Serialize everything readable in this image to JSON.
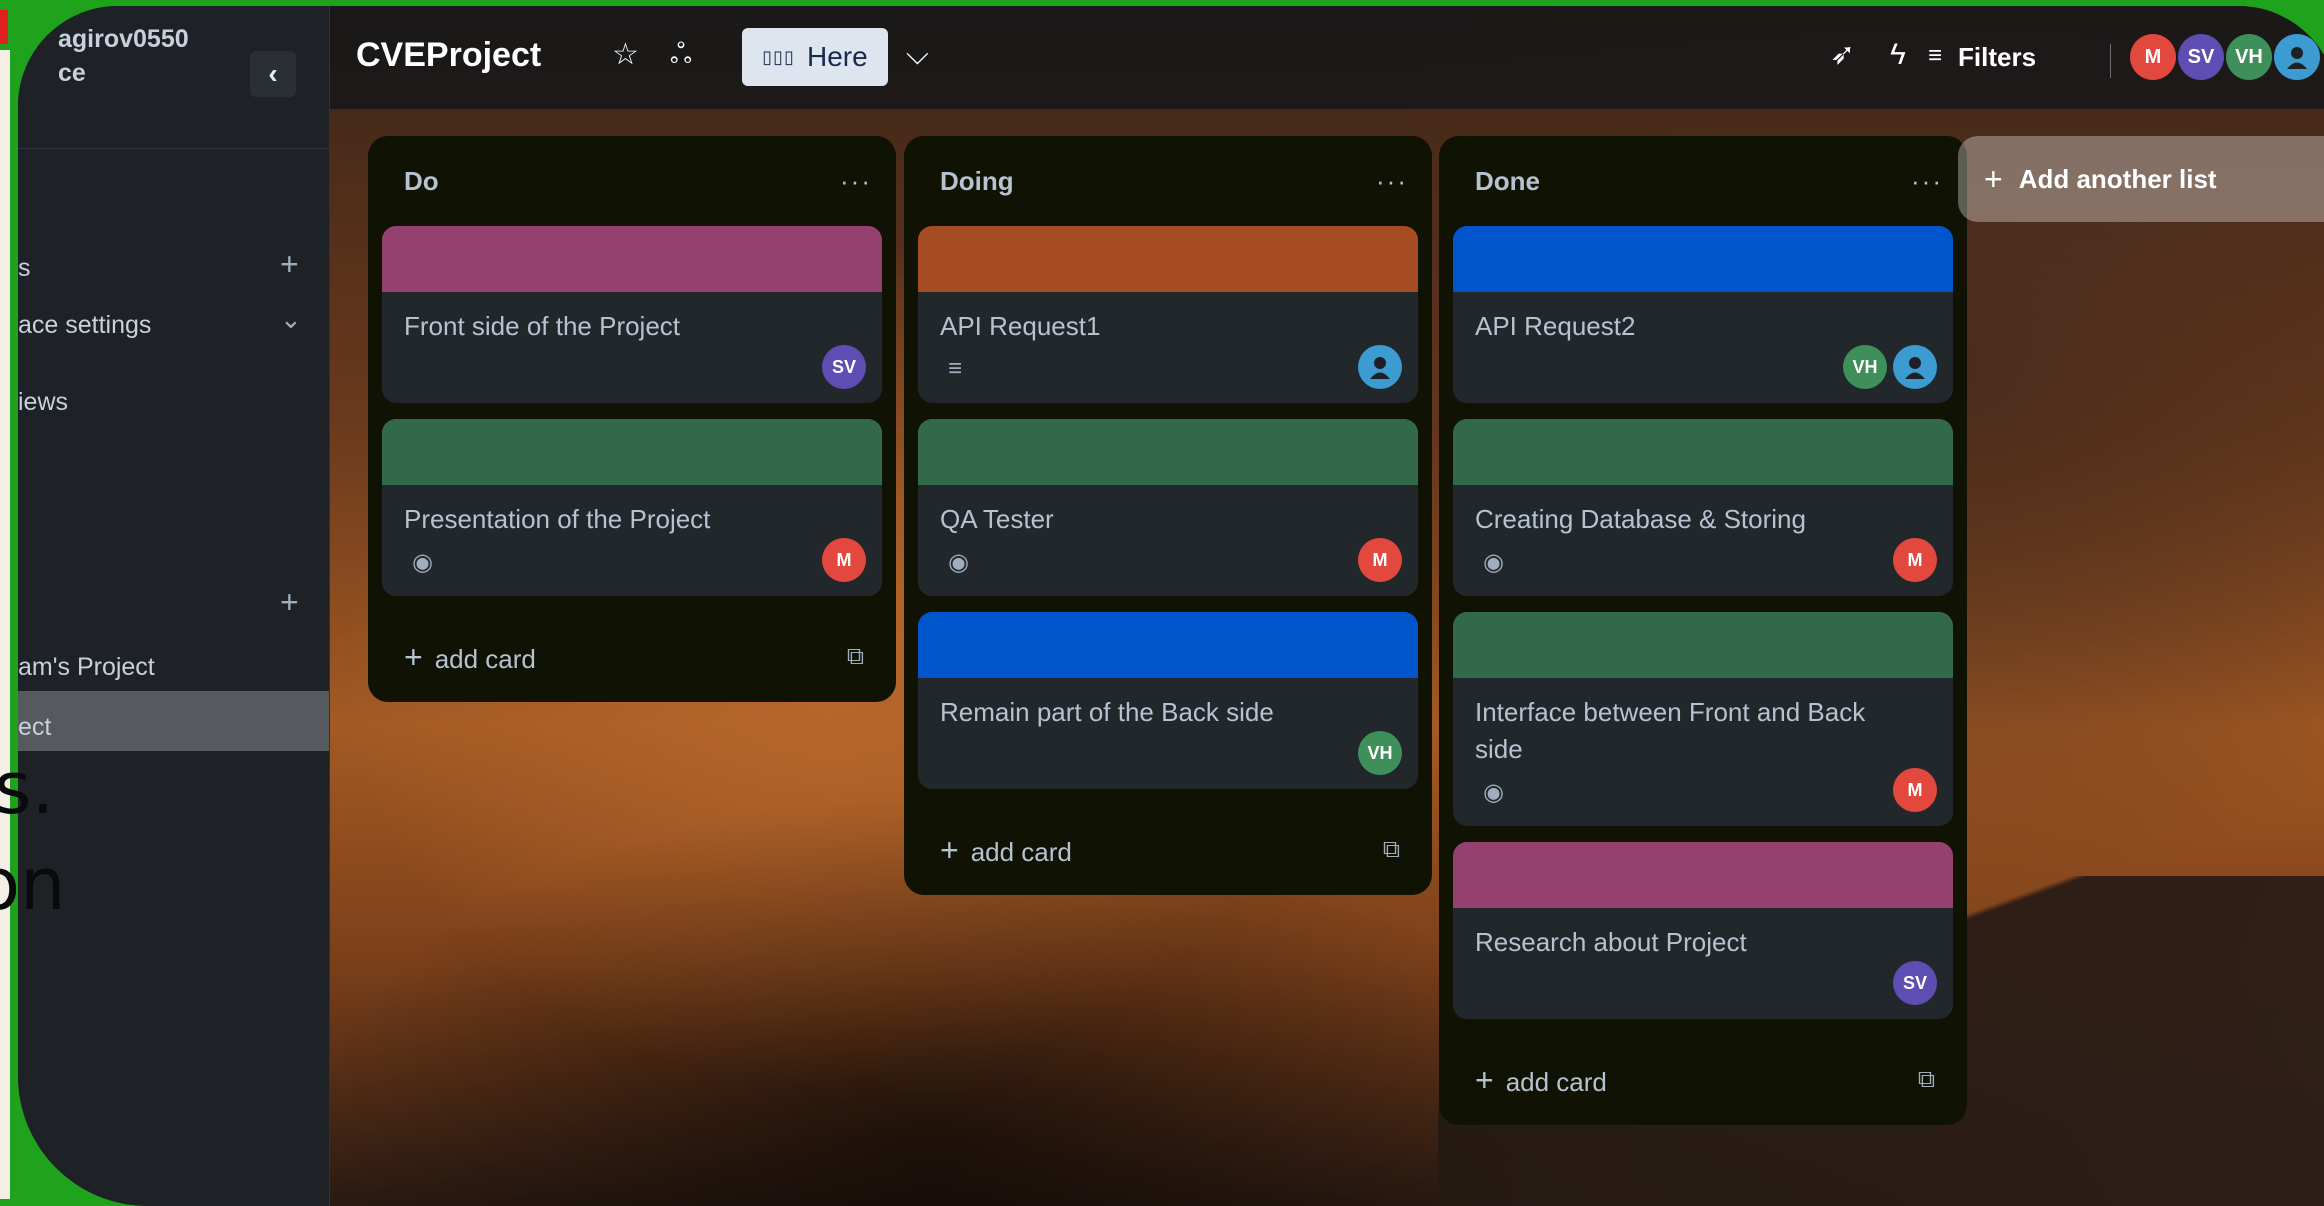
{
  "outer": {
    "overlay_text_1": "s.",
    "overlay_text_2": "on"
  },
  "sidebar": {
    "workspace_name_line1": "agirov0550",
    "workspace_name_line2": "ce",
    "collapse_icon": "chevron-left-icon",
    "items": [
      {
        "label": "s"
      },
      {
        "label": "ace settings"
      },
      {
        "label": "iews"
      }
    ],
    "boards": [
      {
        "label": "am's Project"
      },
      {
        "label": "ect"
      }
    ]
  },
  "topbar": {
    "board_title": "CVEProject",
    "view_label": "Here",
    "filters_label": "Filters",
    "members": [
      {
        "initials": "M",
        "color": "#e2483d"
      },
      {
        "initials": "SV",
        "color": "#5e4db2"
      },
      {
        "initials": "VH",
        "color": "#3f8f5a"
      },
      {
        "initials": "",
        "color": "#3c9bd1"
      }
    ]
  },
  "lists": [
    {
      "title": "Do",
      "menu": "···",
      "add_card": "add card",
      "cards": [
        {
          "title": "Front side of the Project",
          "cover": "#94416f",
          "members": [
            "SV"
          ]
        },
        {
          "title": "Presentation of the Project",
          "cover": "#33694b",
          "members": [
            "M"
          ],
          "badge": "eye-icon"
        }
      ]
    },
    {
      "title": "Doing",
      "menu": "···",
      "add_card": "add card",
      "cards": [
        {
          "title": "API Request1",
          "cover": "#a54c22",
          "members": [
            ""
          ],
          "badge": "description-icon"
        },
        {
          "title": "QA Tester",
          "cover": "#33694b",
          "members": [
            "M"
          ],
          "badge": "eye-icon"
        },
        {
          "title": "Remain part of the Back side",
          "cover": "#0055cc",
          "members": [
            "VH"
          ]
        }
      ]
    },
    {
      "title": "Done",
      "menu": "···",
      "add_card": "add card",
      "cards": [
        {
          "title": "API Request2",
          "cover": "#0055cc",
          "members": [
            "VH",
            ""
          ]
        },
        {
          "title": "Creating Database & Storing",
          "cover": "#33694b",
          "members": [
            "M"
          ],
          "badge": "eye-icon"
        },
        {
          "title": "Interface between Front and Back side",
          "cover": "#33694b",
          "members": [
            "M"
          ],
          "badge": "eye-icon"
        },
        {
          "title": "Research about Project",
          "cover": "#94416f",
          "members": [
            "SV"
          ]
        }
      ]
    }
  ],
  "add_list_label": "Add another list",
  "colors": {
    "sv": "#5e4db2",
    "m": "#e2483d",
    "vh": "#3f8f5a",
    "person": "#3c9bd1"
  }
}
